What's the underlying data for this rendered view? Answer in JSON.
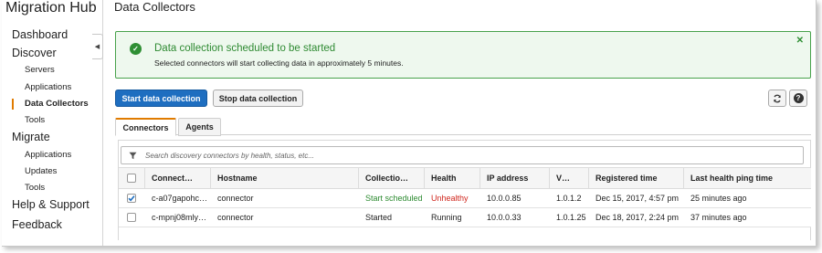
{
  "app": {
    "title": "Migration Hub"
  },
  "sidebar": {
    "items": [
      {
        "label": "Dashboard",
        "level": 1
      },
      {
        "label": "Discover",
        "level": 1
      },
      {
        "label": "Servers",
        "level": 2
      },
      {
        "label": "Applications",
        "level": 2
      },
      {
        "label": "Data Collectors",
        "level": 2,
        "active": true
      },
      {
        "label": "Tools",
        "level": 2
      },
      {
        "label": "Migrate",
        "level": 1
      },
      {
        "label": "Applications",
        "level": 2
      },
      {
        "label": "Updates",
        "level": 2
      },
      {
        "label": "Tools",
        "level": 2
      },
      {
        "label": "Help & Support",
        "level": 1
      },
      {
        "label": "Feedback",
        "level": 1
      }
    ],
    "collapse_icon": "chevron-left-icon"
  },
  "page": {
    "title": "Data Collectors"
  },
  "flash": {
    "title": "Data collection scheduled to be started",
    "body": "Selected connectors will start collecting data in approximately 5 minutes.",
    "status_icon": "check-circle-icon",
    "close_icon": "close-icon"
  },
  "toolbar": {
    "start_label": "Start data collection",
    "stop_label": "Stop data collection",
    "refresh_icon": "refresh-icon",
    "help_icon": "help-icon"
  },
  "tabs": [
    {
      "label": "Connectors",
      "active": true
    },
    {
      "label": "Agents",
      "active": false
    }
  ],
  "search": {
    "placeholder": "Search discovery connectors by health, status, etc...",
    "icon": "filter-icon"
  },
  "table": {
    "columns": [
      "Connect…",
      "Hostname",
      "Collectio…",
      "Health",
      "IP address",
      "V…",
      "Registered time",
      "Last health ping time"
    ],
    "rows": [
      {
        "selected": true,
        "cells": [
          "c-a07gapohc…",
          "connector",
          "Start scheduled",
          "Unhealthy",
          "10.0.0.85",
          "1.0.1.2",
          "Dec 15, 2017, 4:57 pm",
          "25 minutes ago"
        ]
      },
      {
        "selected": false,
        "cells": [
          "c-mpnj08mly…",
          "connector",
          "Started",
          "Running",
          "10.0.0.33",
          "1.0.1.25",
          "Dec 18, 2017, 2:24 pm",
          "37 minutes ago"
        ]
      }
    ]
  },
  "colors": {
    "primary": "#1e6ec0",
    "success": "#2b8a2f",
    "danger": "#d0261d",
    "accent": "#e07b00"
  }
}
